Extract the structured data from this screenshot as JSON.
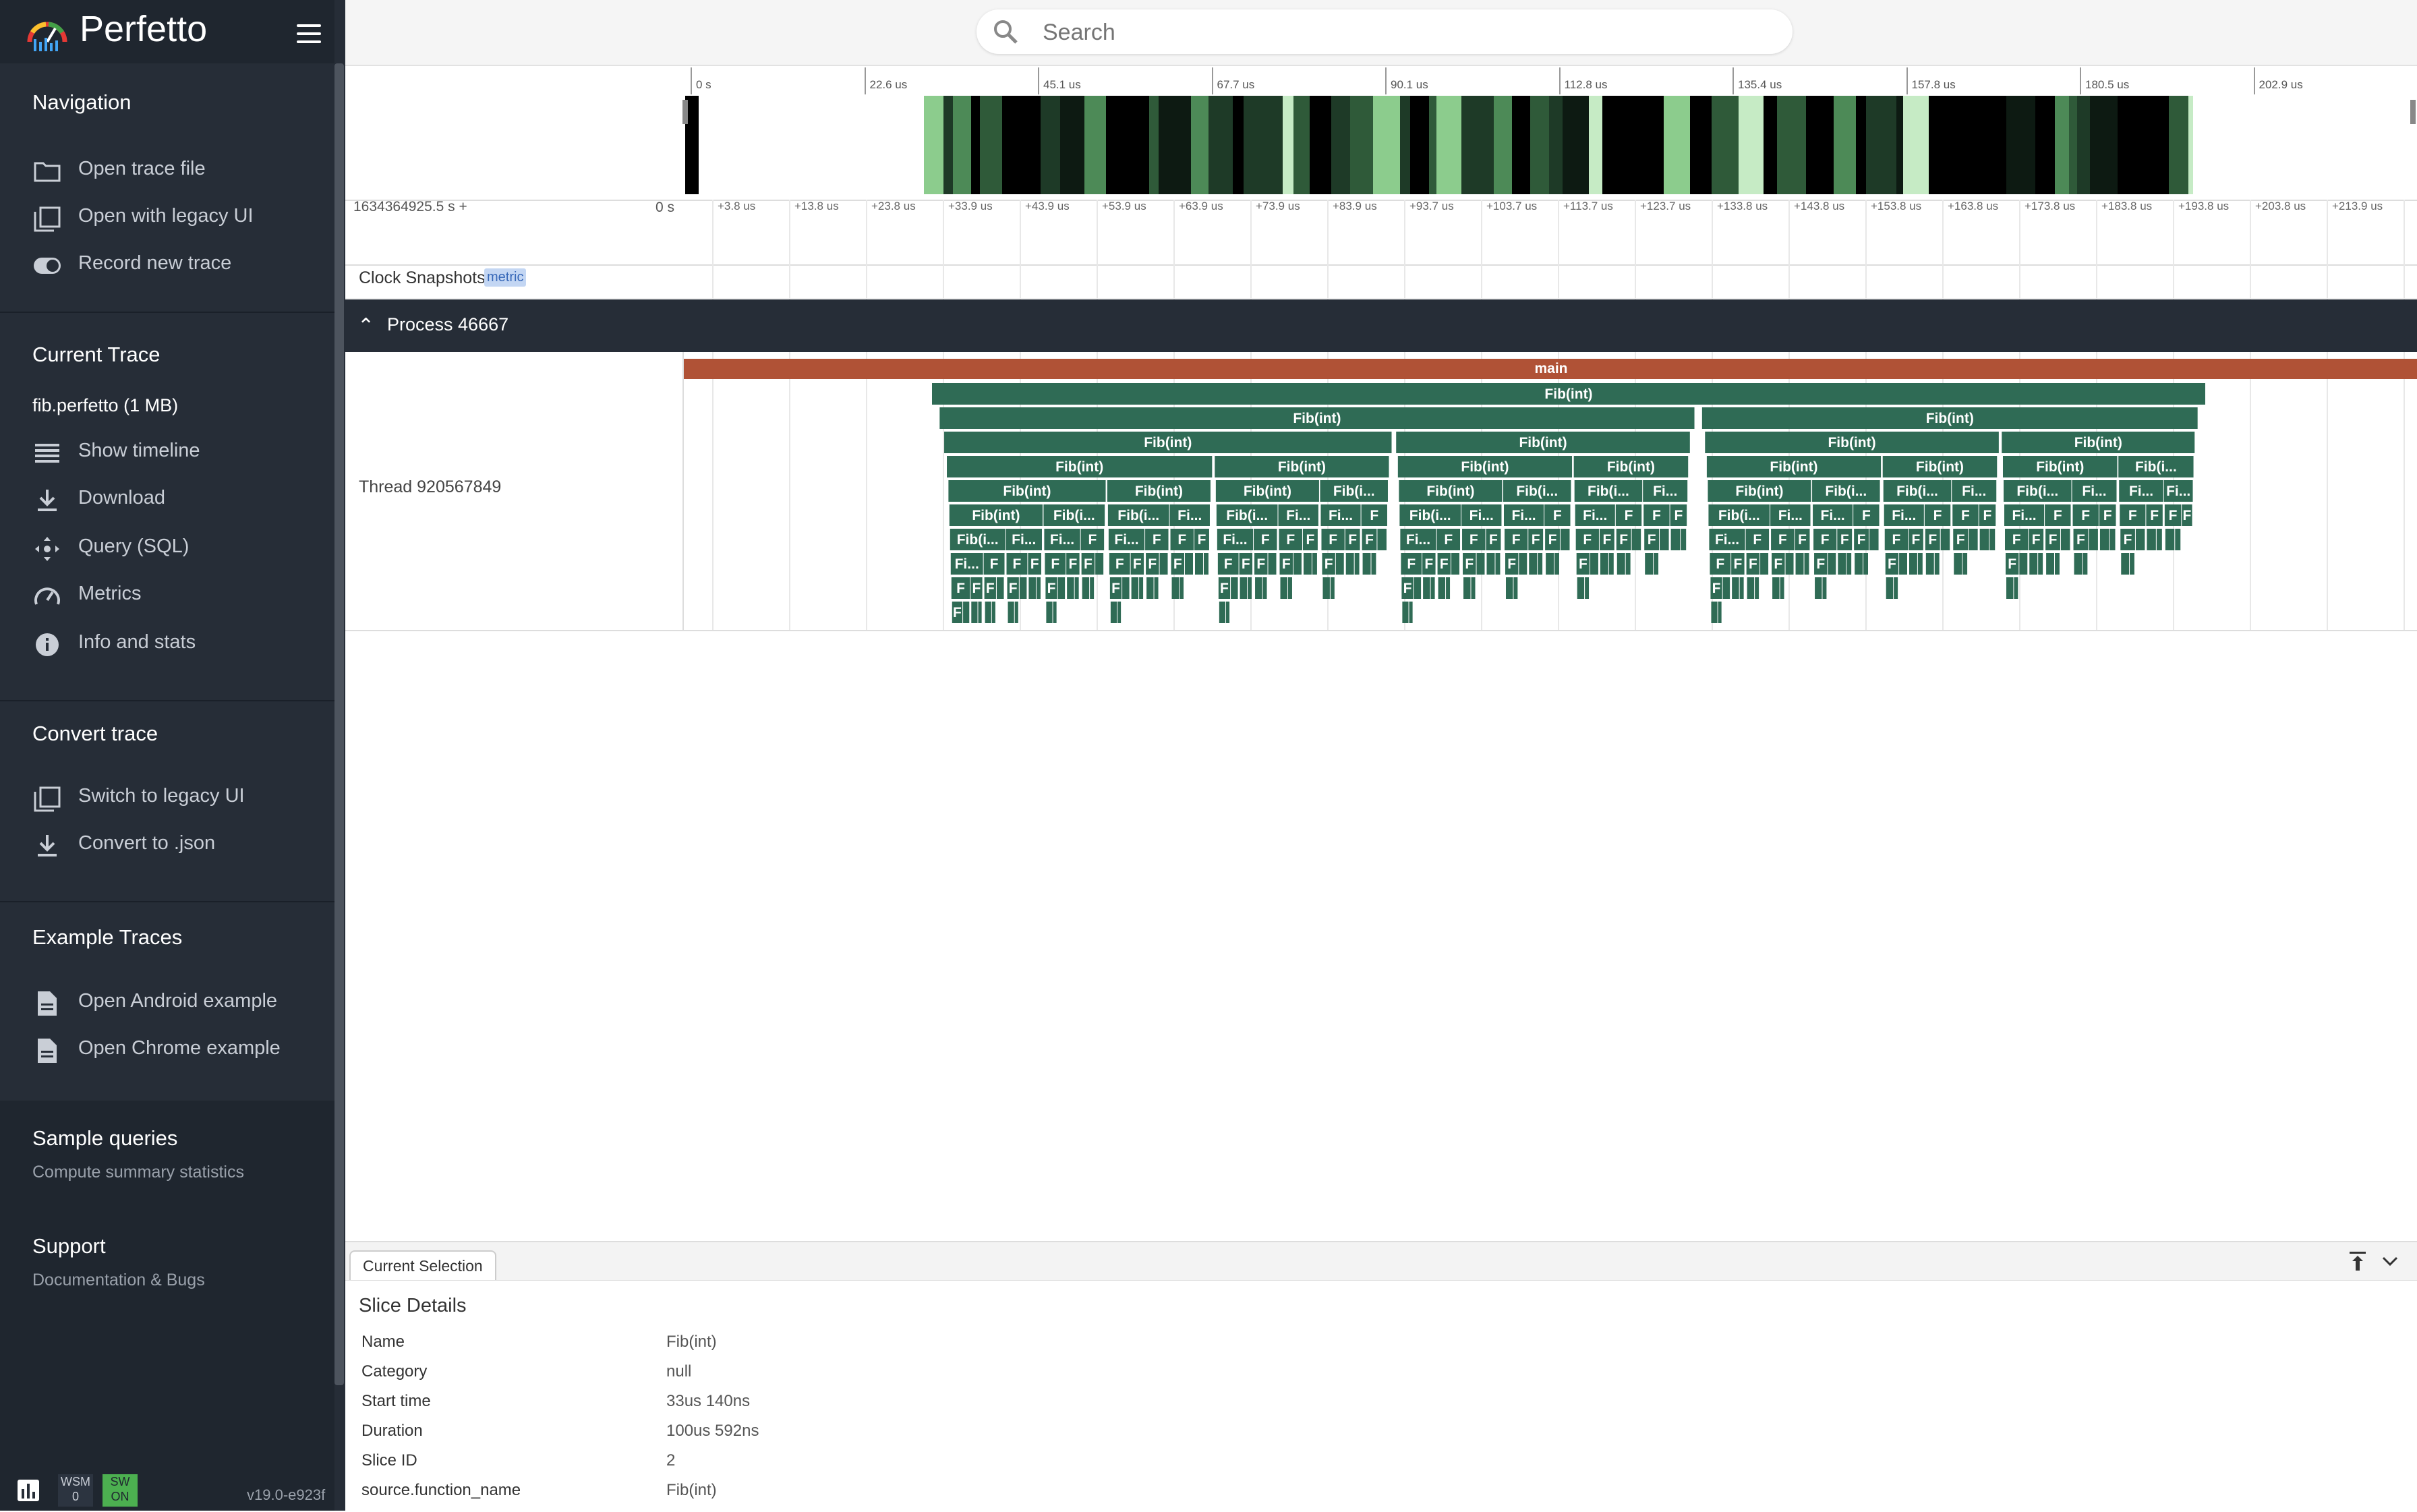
{
  "app": {
    "name": "Perfetto",
    "version": "v19.0-e923f"
  },
  "sidebar": {
    "navigation": {
      "title": "Navigation",
      "items": [
        {
          "label": "Open trace file",
          "icon": "folder-icon"
        },
        {
          "label": "Open with legacy UI",
          "icon": "filter-none-icon"
        },
        {
          "label": "Record new trace",
          "icon": "toggle-icon"
        }
      ]
    },
    "current_trace": {
      "title": "Current Trace",
      "trace_name": "fib.perfetto (1 MB)",
      "items": [
        {
          "label": "Show timeline",
          "icon": "timeline-icon"
        },
        {
          "label": "Download",
          "icon": "download-icon"
        },
        {
          "label": "Query (SQL)",
          "icon": "control-camera-icon"
        },
        {
          "label": "Metrics",
          "icon": "speed-icon"
        },
        {
          "label": "Info and stats",
          "icon": "info-icon"
        }
      ]
    },
    "convert_trace": {
      "title": "Convert trace",
      "items": [
        {
          "label": "Switch to legacy UI",
          "icon": "filter-none-icon"
        },
        {
          "label": "Convert to .json",
          "icon": "download-icon"
        }
      ]
    },
    "example_traces": {
      "title": "Example Traces",
      "items": [
        {
          "label": "Open Android example",
          "icon": "description-icon"
        },
        {
          "label": "Open Chrome example",
          "icon": "description-icon"
        }
      ]
    },
    "sample_queries": {
      "title": "Sample queries",
      "subtitle": "Compute summary statistics"
    },
    "support": {
      "title": "Support",
      "subtitle": "Documentation & Bugs"
    },
    "footer": {
      "wsm_label": "WSM",
      "wsm_value": "0",
      "sw_label": "SW",
      "sw_value": "ON"
    }
  },
  "search": {
    "placeholder": "Search"
  },
  "overview": {
    "ticks": [
      "0 s",
      "22.6 us",
      "45.1 us",
      "67.7 us",
      "90.1 us",
      "112.8 us",
      "135.4 us",
      "157.8 us",
      "180.5 us",
      "202.9 us"
    ]
  },
  "ruler": {
    "offset_label": "1634364925.5 s +",
    "zero_label": "0 s",
    "ticks": [
      "+3.8 us",
      "+13.8 us",
      "+23.8 us",
      "+33.9 us",
      "+43.9 us",
      "+53.9 us",
      "+63.9 us",
      "+73.9 us",
      "+83.9 us",
      "+93.7 us",
      "+103.7 us",
      "+113.7 us",
      "+123.7 us",
      "+133.8 us",
      "+143.8 us",
      "+153.8 us",
      "+163.8 us",
      "+173.8 us",
      "+183.8 us",
      "+193.8 us",
      "+203.8 us",
      "+213.9 us"
    ]
  },
  "tracks": {
    "clock": {
      "label": "Clock Snapshots",
      "chip": "metric"
    },
    "process": {
      "label": "Process 46667"
    },
    "thread": {
      "label": "Thread 920567849"
    }
  },
  "slices": {
    "main": "main",
    "fib": "Fib(int)",
    "fib_trunc": "Fib(i...",
    "fi_trunc": "Fi...",
    "f_trunc": "F",
    "colors": {
      "main": "#b05236",
      "fib": "#2f6b55",
      "fib_selected": "#244f40"
    }
  },
  "details": {
    "tab": "Current Selection",
    "title": "Slice Details",
    "rows": [
      {
        "key": "Name",
        "value": "Fib(int)"
      },
      {
        "key": "Category",
        "value": "null"
      },
      {
        "key": "Start time",
        "value": "33us 140ns"
      },
      {
        "key": "Duration",
        "value": "100us 592ns"
      },
      {
        "key": "Slice ID",
        "value": "2"
      },
      {
        "key": "source.function_name",
        "value": "Fib(int)"
      }
    ]
  }
}
